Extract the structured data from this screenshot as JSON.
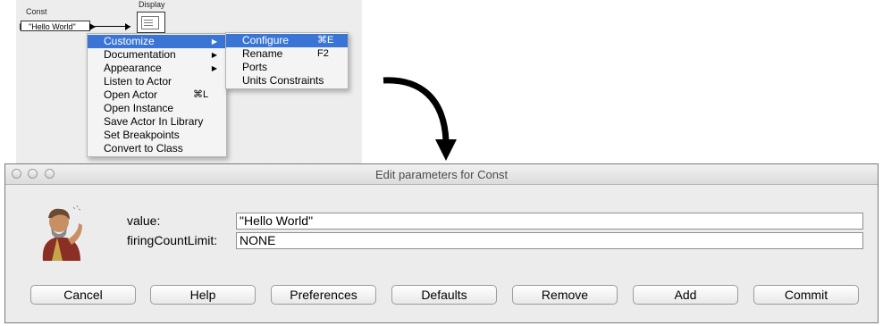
{
  "canvas": {
    "const_label": "Const",
    "const_value": "\"Hello World\"",
    "display_label": "Display"
  },
  "context_menu": {
    "items": [
      {
        "label": "Customize",
        "has_submenu": true,
        "active": true
      },
      {
        "label": "Documentation",
        "has_submenu": true
      },
      {
        "label": "Appearance",
        "has_submenu": true
      },
      {
        "label": "Listen to Actor"
      },
      {
        "label": "Open Actor",
        "shortcut": "⌘L"
      },
      {
        "label": "Open Instance"
      },
      {
        "label": "Save Actor In Library"
      },
      {
        "label": "Set Breakpoints"
      },
      {
        "label": "Convert to Class"
      }
    ]
  },
  "submenu": {
    "items": [
      {
        "label": "Configure",
        "shortcut": "⌘E",
        "active": true
      },
      {
        "label": "Rename",
        "shortcut": "F2"
      },
      {
        "label": "Ports"
      },
      {
        "label": "Units Constraints"
      }
    ]
  },
  "dialog": {
    "title": "Edit parameters for Const",
    "params": [
      {
        "label": "value:",
        "value": "\"Hello World\""
      },
      {
        "label": "firingCountLimit:",
        "value": "NONE"
      }
    ],
    "buttons": [
      "Cancel",
      "Help",
      "Preferences",
      "Defaults",
      "Remove",
      "Add",
      "Commit"
    ]
  },
  "colors": {
    "menu_highlight": "#3a75d6",
    "dialog_bg": "#ececec",
    "canvas_bg": "#ededed"
  }
}
